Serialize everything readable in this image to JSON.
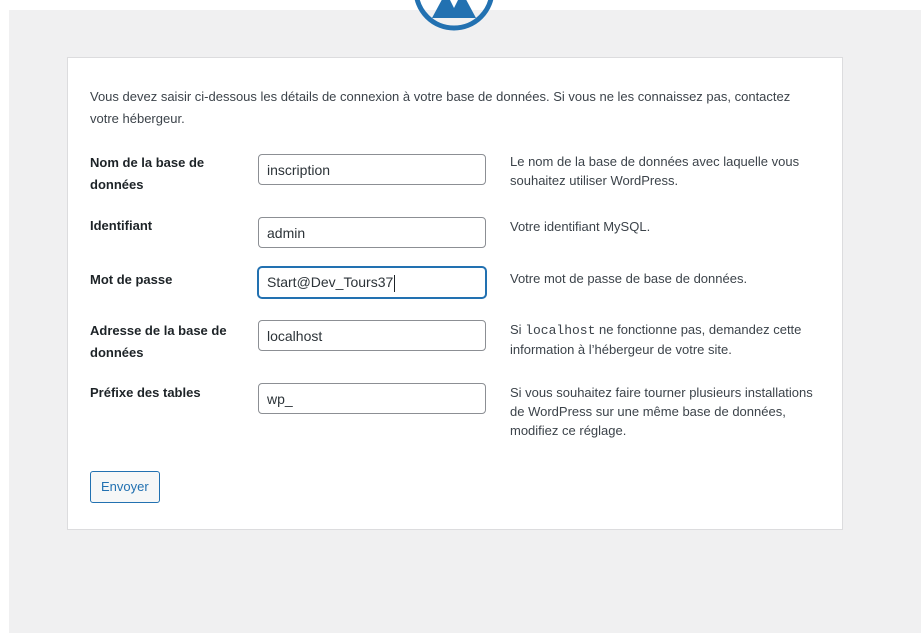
{
  "intro": "Vous devez saisir ci-dessous les détails de connexion à votre base de données. Si vous ne les connaissez pas, contactez votre hébergeur.",
  "fields": {
    "dbname": {
      "label": "Nom de la base de données",
      "value": "inscription",
      "help": "Le nom de la base de données avec laquelle vous souhaitez utiliser WordPress."
    },
    "username": {
      "label": "Identifiant",
      "value": "admin",
      "help": "Votre identifiant MySQL."
    },
    "password": {
      "label": "Mot de passe",
      "value": "Start@Dev_Tours37",
      "help": "Votre mot de passe de base de données."
    },
    "host": {
      "label": "Adresse de la base de données",
      "value": "localhost",
      "help_prefix": "Si",
      "help_code": "localhost",
      "help_suffix": "ne fonctionne pas, demandez cette information à l’hébergeur de votre site."
    },
    "prefix": {
      "label": "Préfixe des tables",
      "value": "wp_",
      "help": "Si vous souhaitez faire tourner plusieurs installations de WordPress sur une même base de données, modifiez ce réglage."
    }
  },
  "submit_label": "Envoyer",
  "colors": {
    "accent": "#2271b1",
    "logo": "#2271b1",
    "background": "#f0f0f1"
  },
  "icons": {
    "logo": "wordpress-logo-icon"
  }
}
